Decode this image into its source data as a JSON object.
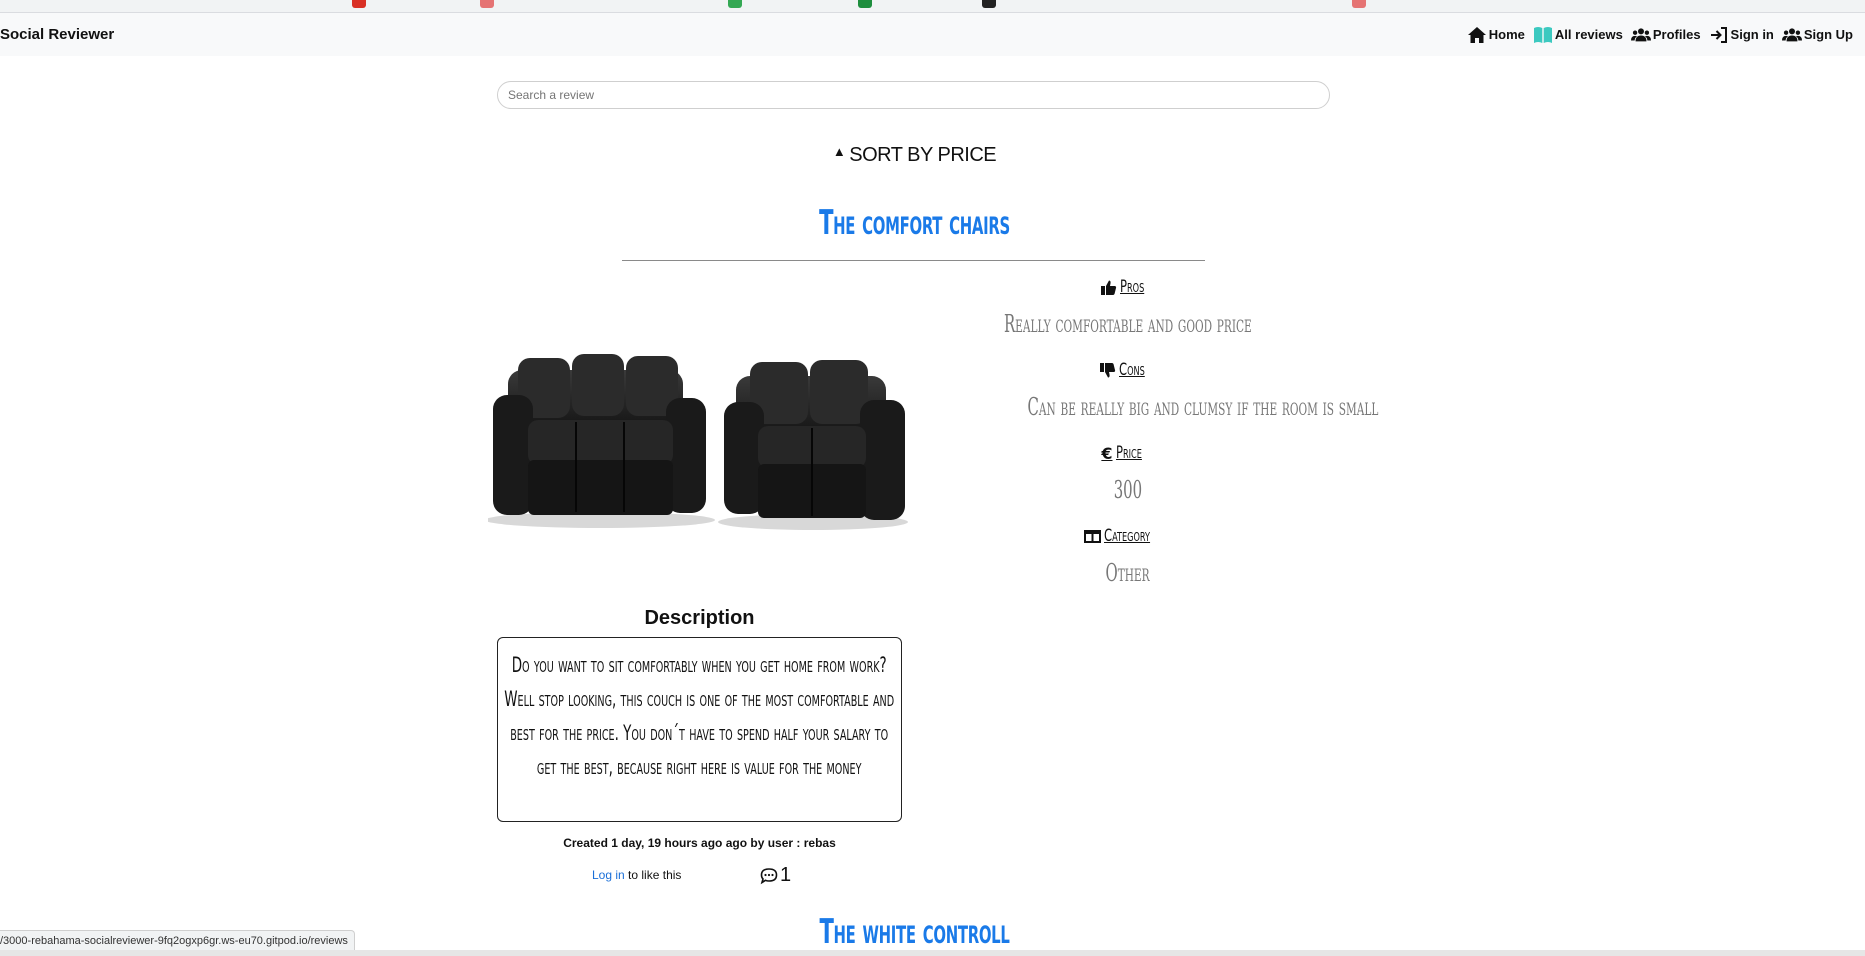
{
  "navbar": {
    "brand": "Social Reviewer",
    "links": [
      {
        "label": "Home",
        "icon": "home-icon"
      },
      {
        "label": "All reviews",
        "icon": "book-icon"
      },
      {
        "label": "Profiles",
        "icon": "users-icon"
      },
      {
        "label": "Sign in",
        "icon": "sign-in-icon"
      },
      {
        "label": "Sign Up",
        "icon": "user-plus-icon"
      }
    ]
  },
  "search": {
    "placeholder": "Search a review"
  },
  "sort": {
    "label": "SORT BY PRICE",
    "icon": "caret-up-icon"
  },
  "reviews": [
    {
      "title": "The comfort chairs",
      "image": "black-leather-sofas",
      "details": [
        {
          "label": "Pros",
          "icon": "thumbs-up-icon",
          "value": "Really comfortable and good price"
        },
        {
          "label": "Cons",
          "icon": "thumbs-down-icon",
          "value": "Can be really big and clumsy if the room is small"
        },
        {
          "label": "Price",
          "icon": "euro-icon",
          "value": "300"
        },
        {
          "label": "Category",
          "icon": "category-icon",
          "value": "Other"
        }
      ],
      "description_heading": "Description",
      "description": "Do you want to sit comfortably when you get home from work? Well stop looking, this couch is one of the most comfortable and best for the price. You don´t have to spend half your salary to get the best, because right here is value for the money",
      "created": "Created 1 day, 19 hours ago ago by user : rebas",
      "login_link": "Log in",
      "like_text": "to like this",
      "comment_count": "1"
    },
    {
      "title": "The white controll"
    }
  ],
  "status_url": "/3000-rebahama-socialreviewer-9fq2ogxp6gr.ws-eu70.gitpod.io/reviews",
  "colors": {
    "accent": "#1a7ae8",
    "link": "#1a6fd8",
    "muted": "#777777",
    "navbar_bg": "#f8f9fa"
  }
}
